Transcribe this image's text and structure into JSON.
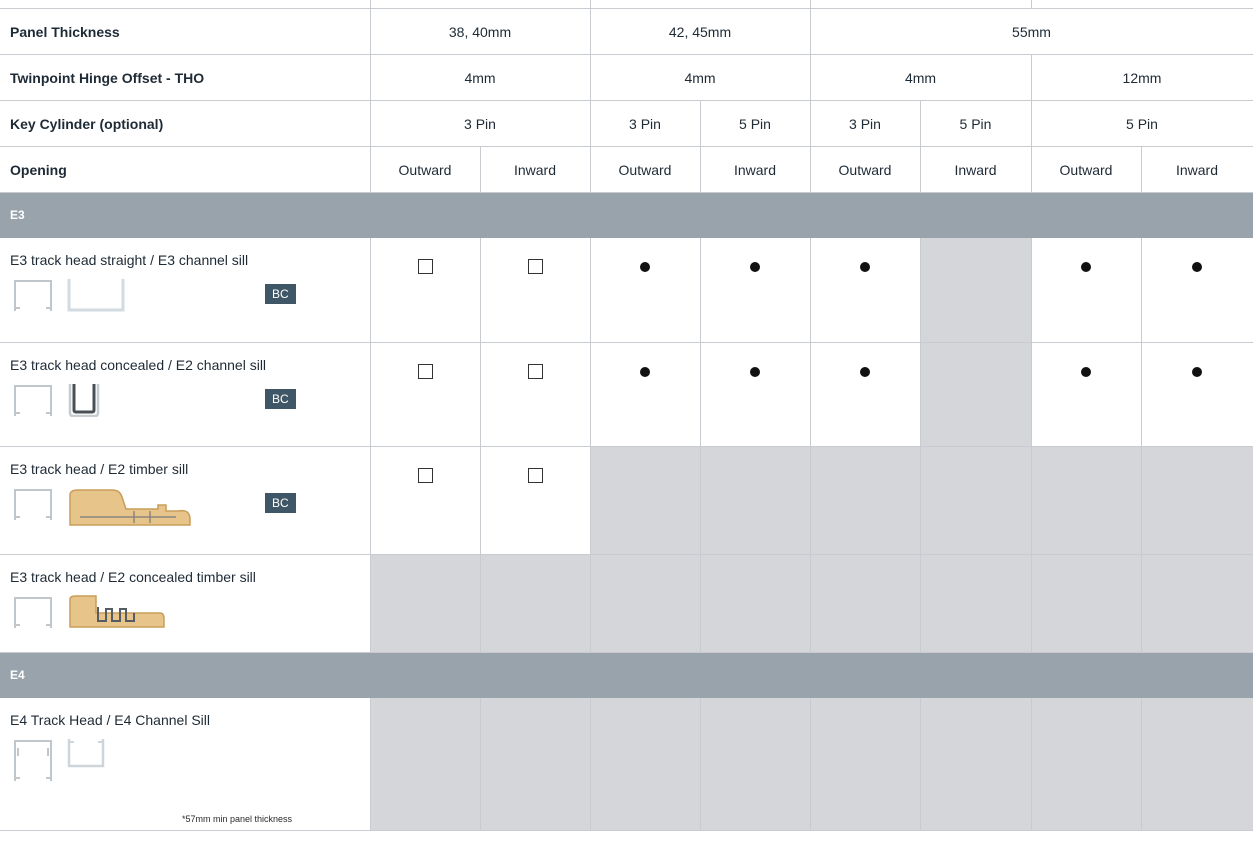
{
  "header": {
    "panel_thickness": {
      "label": "Panel Thickness",
      "groups": [
        "38, 40mm",
        "42, 45mm",
        "55mm"
      ]
    },
    "hinge_offset": {
      "label": "Twinpoint Hinge Offset - THO",
      "groups": [
        "4mm",
        "4mm",
        "4mm",
        "12mm"
      ]
    },
    "key_cylinder": {
      "label": "Key Cylinder (optional)",
      "groups": [
        "3 Pin",
        "3 Pin",
        "5 Pin",
        "3 Pin",
        "5 Pin",
        "5 Pin"
      ]
    },
    "opening": {
      "label": "Opening",
      "values": [
        "Outward",
        "Inward",
        "Outward",
        "Inward",
        "Outward",
        "Inward",
        "Outward",
        "Inward"
      ]
    }
  },
  "sections": [
    {
      "title": "E3",
      "rows": [
        {
          "label": "E3 track head straight / E3 channel sill",
          "badge": "BC",
          "cells": [
            "box",
            "box",
            "dot",
            "dot",
            "dot",
            "na",
            "dot",
            "dot"
          ]
        },
        {
          "label": "E3 track head concealed / E2 channel sill",
          "badge": "BC",
          "cells": [
            "box",
            "box",
            "dot",
            "dot",
            "dot",
            "na",
            "dot",
            "dot"
          ]
        },
        {
          "label": "E3 track head / E2 timber sill",
          "badge": "BC",
          "cells": [
            "box",
            "box",
            "na",
            "na",
            "na",
            "na",
            "na",
            "na"
          ]
        },
        {
          "label": "E3 track head / E2 concealed timber sill",
          "cells": [
            "na",
            "na",
            "na",
            "na",
            "na",
            "na",
            "na",
            "na"
          ]
        }
      ]
    },
    {
      "title": "E4",
      "rows": [
        {
          "label": "E4 Track Head / E4 Channel Sill",
          "note": "*57mm min panel thickness",
          "cells": [
            "na",
            "na",
            "na",
            "na",
            "na",
            "na",
            "na",
            "na"
          ]
        }
      ]
    }
  ],
  "colors": {
    "section_band": "#98a3ac",
    "unavailable_cell": "#d4d6d9",
    "badge": "#3e5666",
    "grid": "#c8ccd0"
  }
}
